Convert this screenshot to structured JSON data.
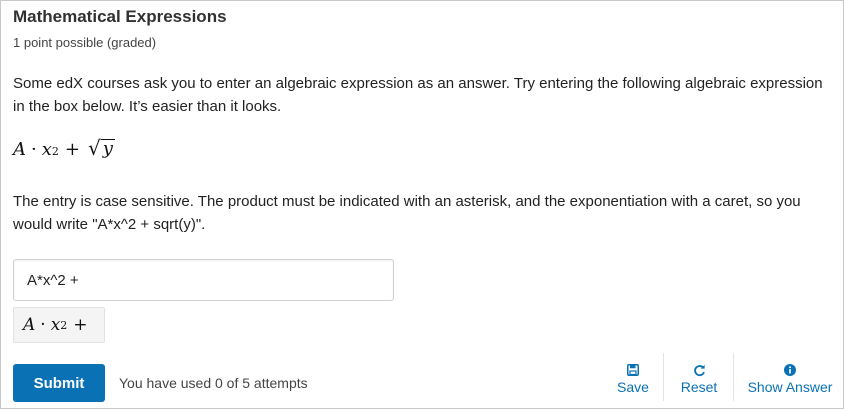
{
  "problem": {
    "title": "Mathematical Expressions",
    "points": "1 point possible (graded)",
    "intro": "Some edX courses ask you to enter an algebraic expression as an answer. Try entering the following algebraic expression in the box below. It’s easier than it looks.",
    "instructions": "The entry is case sensitive. The product must be indicated with an asterisk, and the exponentiation with a caret, so you would write \"A*x^2 + sqrt(y)\".",
    "formula": {
      "a": "A",
      "dot": "·",
      "x": "x",
      "exp": "2",
      "plus": "+",
      "y": "y"
    }
  },
  "answer": {
    "value": "A*x^2 +",
    "preview": {
      "a": "A",
      "dot": "·",
      "x": "x",
      "exp": "2",
      "plus": "+"
    }
  },
  "actions": {
    "submit_label": "Submit",
    "attempts_text": "You have used 0 of 5 attempts",
    "save_label": "Save",
    "reset_label": "Reset",
    "show_answer_label": "Show Answer"
  },
  "colors": {
    "accent": "#0a72b4",
    "border": "#c8c8c8"
  },
  "icons": {
    "save": "floppy-disk-icon",
    "reset": "refresh-icon",
    "show_answer": "info-circle-icon"
  }
}
